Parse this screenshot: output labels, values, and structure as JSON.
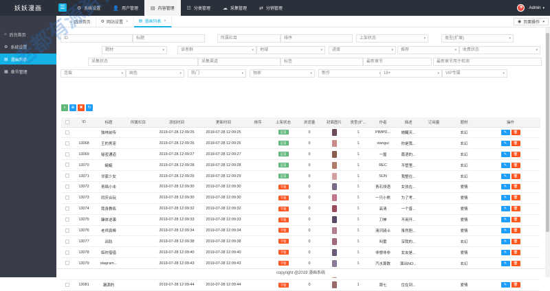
{
  "app": {
    "logo": "妖妖漫画"
  },
  "nav": {
    "items": [
      {
        "label": "系统设置",
        "icon": "gear-icon",
        "glyph": "⚙",
        "active": false
      },
      {
        "label": "用户管理",
        "icon": "user-icon",
        "glyph": "👤",
        "active": false
      },
      {
        "label": "内容管理",
        "icon": "document-icon",
        "glyph": "▤",
        "active": true
      },
      {
        "label": "分类管理",
        "icon": "grid-icon",
        "glyph": "☷",
        "active": false
      },
      {
        "label": "采集管理",
        "icon": "cloud-icon",
        "glyph": "☁",
        "active": false
      },
      {
        "label": "分销管理",
        "icon": "share-icon",
        "glyph": "⇄",
        "active": false
      }
    ],
    "user": "Admin"
  },
  "sidebar": {
    "items": [
      {
        "label": "后台首页",
        "glyph": "⌂",
        "active": false
      },
      {
        "label": "系统设置",
        "glyph": "⚙",
        "active": false
      },
      {
        "label": "漫画列表",
        "glyph": "▤",
        "active": true
      },
      {
        "label": "章节管理",
        "glyph": "▦",
        "active": false
      }
    ]
  },
  "tabs": {
    "items": [
      {
        "label": "后台首页",
        "glyph": "⌂",
        "closable": false,
        "active": false
      },
      {
        "label": "网站设置",
        "glyph": "⚙",
        "closable": true,
        "active": false
      },
      {
        "label": "漫画列表",
        "glyph": "▤",
        "closable": true,
        "active": true
      }
    ],
    "page_op": "页面操作"
  },
  "filters": {
    "row1": [
      "ID",
      "标题",
      "所属栏目",
      "排序",
      "上架状态",
      "类型(扩展)"
    ],
    "row2": [
      "题材",
      "读者群",
      "地域",
      "进度",
      "推荐",
      "收费状态"
    ],
    "row3": [
      "采集状态",
      "采集渠道",
      "标签",
      "最新章节",
      "最新章节用于检测"
    ],
    "row4": [
      "连载",
      "画色",
      "热门",
      "独家",
      "新作",
      "18+",
      "VIP专属"
    ]
  },
  "table": {
    "headers": [
      "",
      "ID",
      "标题",
      "所属栏目",
      "添加时间",
      "更新时间",
      "排序",
      "上架状态",
      "浏览量",
      "封面图片",
      "类型(扩...",
      "作者",
      "描述",
      "订阅量",
      "题材",
      "操作"
    ],
    "on_label": "正常",
    "off_label": "下架",
    "edit_label": "✎",
    "del_label": "🗑",
    "rows": [
      {
        "id": "",
        "title": "独林前传",
        "added": "2019-07-28 12:09:25",
        "updated": "2019-07-28 12:09:25",
        "status": "on",
        "views": "0",
        "type": "1",
        "author": "PIMPD...",
        "desc": "她醒天...",
        "genre": "玄幻",
        "cover": "#6b4a5c"
      },
      {
        "id": "13068",
        "title": "王的男宠",
        "added": "2019-07-28 12:09:26",
        "updated": "2019-07-28 12:09:26",
        "status": "on",
        "views": "0",
        "type": "1",
        "author": "xiaogui",
        "desc": "你是我...",
        "genre": "玄幻",
        "cover": "#c98a8a"
      },
      {
        "id": "13069",
        "title": "秘密通道",
        "added": "2019-07-28 12:09:27",
        "updated": "2019-07-28 12:09:27",
        "status": "on",
        "views": "0",
        "type": "1",
        "author": "一屋",
        "desc": "篇语的...",
        "genre": "玄幻",
        "cover": "#8a5a4a"
      },
      {
        "id": "13070",
        "title": "蜿蜒",
        "added": "2019-07-28 12:09:28",
        "updated": "2019-07-28 12:09:28",
        "status": "on",
        "views": "0",
        "type": "1",
        "author": "REC",
        "desc": "不管里...",
        "genre": "玄幻",
        "cover": "#b07a6a"
      },
      {
        "id": "13071",
        "title": "邻家少女",
        "added": "2019-07-28 12:09:29",
        "updated": "2019-07-28 12:09:29",
        "status": "on",
        "views": "0",
        "type": "1",
        "author": "SUN",
        "desc": "我整住...",
        "genre": "玄幻",
        "cover": "#d4a0a0"
      },
      {
        "id": "13072",
        "title": "青络小击",
        "added": "2019-07-28 12:09:30",
        "updated": "2019-07-28 12:09:30",
        "status": "off",
        "views": "0",
        "type": "1",
        "author": "青石领语",
        "desc": "女孩在...",
        "genre": "爱情",
        "cover": "#7a6a8a"
      },
      {
        "id": "13073",
        "title": "同庆合玩",
        "added": "2019-07-28 12:09:30",
        "updated": "2019-07-28 12:09:30",
        "status": "off",
        "views": "0",
        "type": "1",
        "author": "一只小熊",
        "desc": "为了考...",
        "genre": "爱情",
        "cover": "#c07a8a"
      },
      {
        "id": "13074",
        "title": "我身教练",
        "added": "2019-07-28 12:09:32",
        "updated": "2019-07-28 12:09:32",
        "status": "off",
        "views": "0",
        "type": "1",
        "author": "高清",
        "desc": "一个普...",
        "genre": "爱情",
        "cover": "#9a4a5a"
      },
      {
        "id": "13075",
        "title": "臻体逆袭",
        "added": "2019-07-28 12:09:33",
        "updated": "2019-07-28 12:09:33",
        "status": "off",
        "views": "0",
        "type": "1",
        "author": "刀神",
        "desc": "不用开...",
        "genre": "爱情",
        "cover": "#5a4a6a"
      },
      {
        "id": "13076",
        "title": "老师真棒",
        "added": "2019-07-28 12:09:34",
        "updated": "2019-07-28 12:09:34",
        "status": "off",
        "views": "0",
        "type": "1",
        "author": "清河骑士",
        "desc": "虽然胆...",
        "genre": "爱情",
        "cover": "#b08090"
      },
      {
        "id": "13077",
        "title": "出轨",
        "added": "2019-07-28 12:09:38",
        "updated": "2019-07-28 12:09:38",
        "status": "off",
        "views": "0",
        "type": "1",
        "author": "叫蕾",
        "desc": "深我的...",
        "genre": "玄幻",
        "cover": "#a06a7a"
      },
      {
        "id": "13078",
        "title": "临时借借",
        "added": "2019-07-28 12:09:40",
        "updated": "2019-07-28 12:09:40",
        "status": "off",
        "views": "0",
        "type": "1",
        "author": "非想非非",
        "desc": "女友是...",
        "genre": "爱情",
        "cover": "#6a5a7a"
      },
      {
        "id": "13079",
        "title": "stagram...",
        "added": "2019-07-28 12:09:43",
        "updated": "2019-07-28 12:09:43",
        "status": "off",
        "views": "0",
        "type": "1",
        "author": "汽水算数",
        "desc": "面出NO...",
        "genre": "玄幻",
        "cover": "#8a7a9a"
      },
      {
        "id": "13080",
        "title": "逆袭之窗",
        "added": "2019-07-28 12:09:43",
        "updated": "2019-07-28 12:09:43",
        "status": "off",
        "views": "0",
        "type": "1",
        "author": "都不将",
        "desc": "一个普...",
        "genre": "爱情",
        "cover": "#c09080"
      },
      {
        "id": "13081",
        "title": "漏源的",
        "added": "2019-07-28 12:09:44",
        "updated": "2019-07-28 12:09:44",
        "status": "off",
        "views": "0",
        "type": "1",
        "author": "周七",
        "desc": "住在到...",
        "genre": "爱情",
        "cover": "#9a6a6a"
      }
    ]
  },
  "footer": {
    "text": "copyright @2019 漫画系统"
  },
  "watermark": "老都有源资合vip.com资源网",
  "colors": {
    "accent": "#14b1e5",
    "on": "#5fb878",
    "off": "#ff5722",
    "edit": "#1e9fff",
    "topbar": "#2b313a",
    "sidebar": "#393d49"
  }
}
